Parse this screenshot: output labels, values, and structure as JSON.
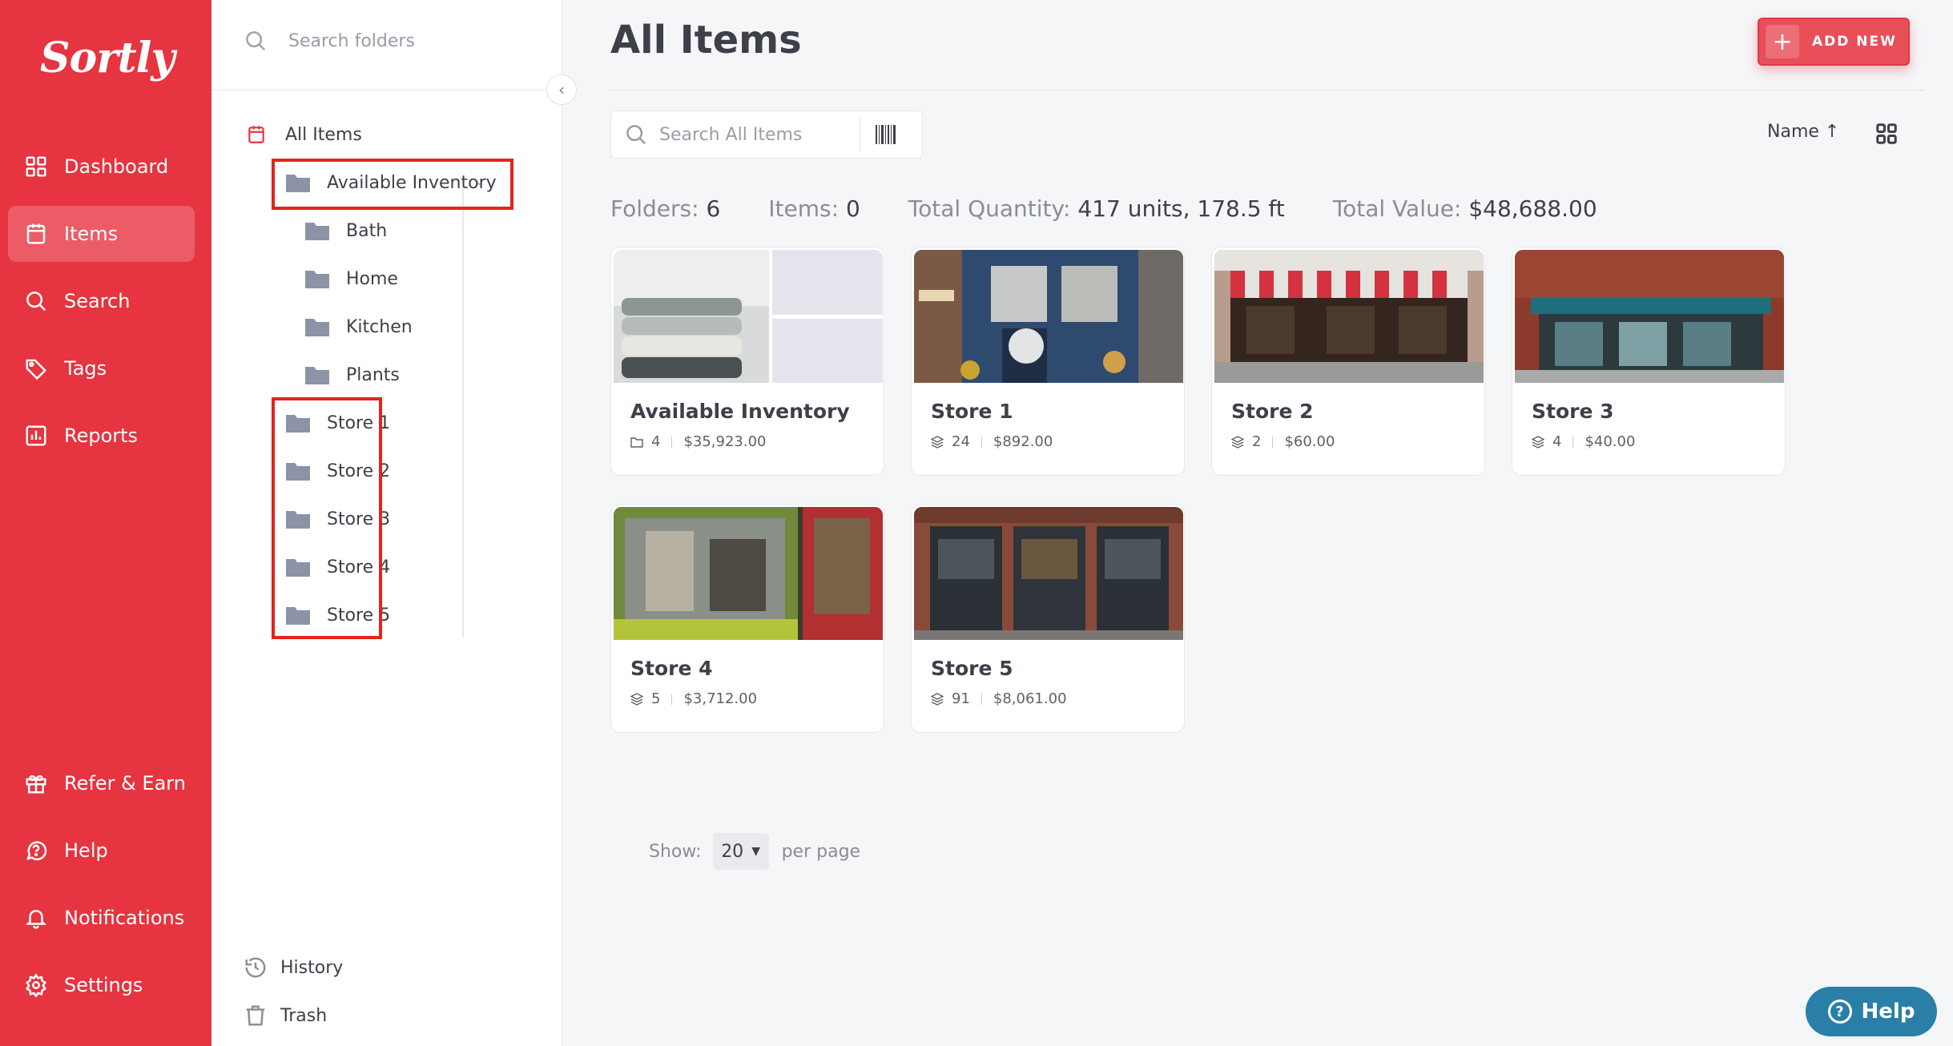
{
  "app": {
    "logo": "Sortly"
  },
  "nav": {
    "items": [
      {
        "label": "Dashboard",
        "icon": "dashboard-icon"
      },
      {
        "label": "Items",
        "icon": "items-icon",
        "active": true
      },
      {
        "label": "Search",
        "icon": "search-icon"
      },
      {
        "label": "Tags",
        "icon": "tag-icon"
      },
      {
        "label": "Reports",
        "icon": "reports-icon"
      }
    ],
    "bottom": [
      {
        "label": "Refer & Earn",
        "icon": "gift-icon"
      },
      {
        "label": "Help",
        "icon": "help-icon"
      },
      {
        "label": "Notifications",
        "icon": "bell-icon"
      },
      {
        "label": "Settings",
        "icon": "gear-icon"
      }
    ]
  },
  "folders": {
    "search_placeholder": "Search folders",
    "root": "All Items",
    "tree": [
      "Available Inventory",
      "Bath",
      "Home",
      "Kitchen",
      "Plants",
      "Store 1",
      "Store 2",
      "Store 3",
      "Store 4",
      "Store 5"
    ],
    "footer": {
      "history": "History",
      "trash": "Trash"
    }
  },
  "main": {
    "title": "All Items",
    "add_label": "ADD NEW",
    "search_placeholder": "Search All Items",
    "sort_label": "Name",
    "stats": {
      "folders_label": "Folders:",
      "folders_value": "6",
      "items_label": "Items:",
      "items_value": "0",
      "quantity_label": "Total Quantity:",
      "quantity_value": "417 units, 178.5 ft",
      "value_label": "Total Value:",
      "value_value": "$48,688.00"
    },
    "cards": [
      {
        "name": "Available Inventory",
        "count": "4",
        "value": "$35,923.00",
        "count_icon": "folder-icon"
      },
      {
        "name": "Store 1",
        "count": "24",
        "value": "$892.00",
        "count_icon": "layers-icon"
      },
      {
        "name": "Store 2",
        "count": "2",
        "value": "$60.00",
        "count_icon": "layers-icon"
      },
      {
        "name": "Store 3",
        "count": "4",
        "value": "$40.00",
        "count_icon": "layers-icon"
      },
      {
        "name": "Store 4",
        "count": "5",
        "value": "$3,712.00",
        "count_icon": "layers-icon"
      },
      {
        "name": "Store 5",
        "count": "91",
        "value": "$8,061.00",
        "count_icon": "layers-icon"
      }
    ],
    "pager": {
      "show_label": "Show:",
      "per_page": "20",
      "per_page_label": "per page"
    }
  },
  "help_fab": {
    "label": "Help"
  },
  "colors": {
    "brand": "#e63440",
    "highlight": "#e3231c",
    "help": "#2a7fa8"
  }
}
